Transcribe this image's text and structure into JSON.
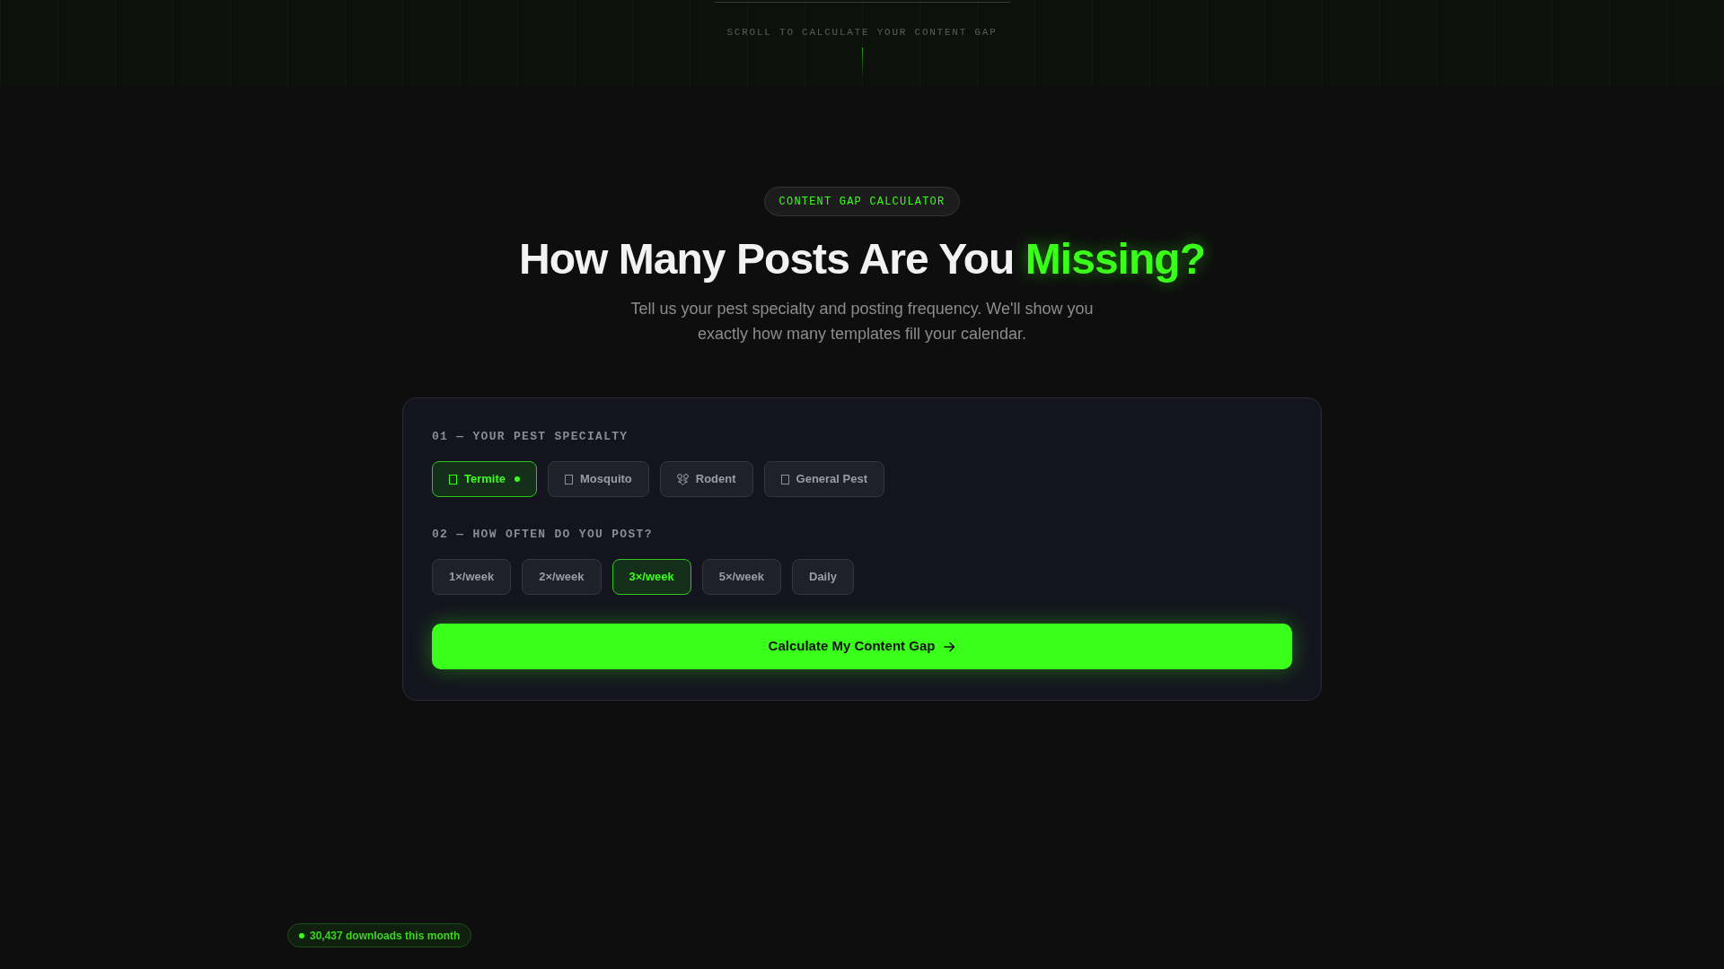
{
  "top_hint": {
    "label": "SCROLL TO CALCULATE YOUR CONTENT GAP"
  },
  "calculator": {
    "badge": "CONTENT GAP CALCULATOR",
    "title_lead": "How Many Posts Are You",
    "title_highlight": "Missing?",
    "subtitle": "Tell us your pest specialty and posting frequency. We'll show you exactly how many templates fill your calendar.",
    "specialty": {
      "label": "01 — YOUR PEST SPECIALTY",
      "options": [
        {
          "label": "Termite",
          "selected": true
        },
        {
          "label": "Mosquito",
          "selected": false
        },
        {
          "label": "Rodent",
          "selected": false
        },
        {
          "label": "General Pest",
          "selected": false
        }
      ]
    },
    "frequency": {
      "label": "02 — HOW OFTEN DO YOU POST?",
      "options": [
        {
          "label": "1×/week",
          "selected": false
        },
        {
          "label": "2×/week",
          "selected": false
        },
        {
          "label": "3×/week",
          "selected": true
        },
        {
          "label": "5×/week",
          "selected": false
        },
        {
          "label": "Daily",
          "selected": false
        }
      ]
    },
    "submit_button": {
      "label": "Calculate My Content Gap"
    }
  },
  "downloads_badge": {
    "label": "30,437 downloads this month"
  }
}
